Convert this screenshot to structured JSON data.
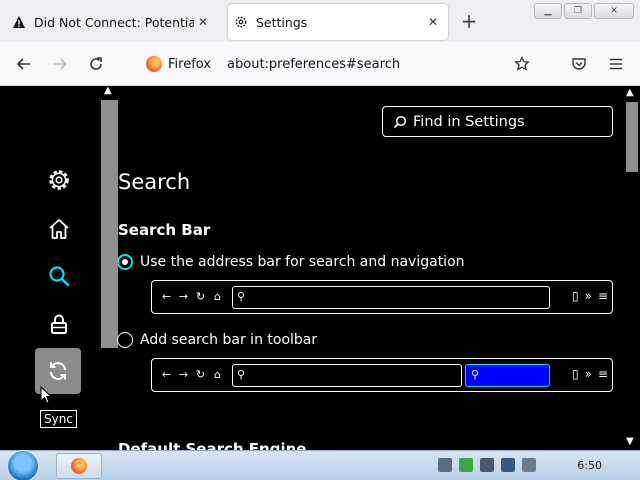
{
  "tabs": [
    {
      "title": "Did Not Connect: Potential Security Issue",
      "icon": "warning-icon"
    },
    {
      "title": "Settings",
      "icon": "gear-icon"
    }
  ],
  "navbar": {
    "brand": "Firefox",
    "url": "about:preferences#search"
  },
  "sidebar": {
    "items": [
      {
        "name": "general",
        "icon": "gear-icon"
      },
      {
        "name": "home",
        "icon": "home-icon"
      },
      {
        "name": "search",
        "icon": "search-icon",
        "selected": true
      },
      {
        "name": "privacy",
        "icon": "lock-icon"
      },
      {
        "name": "sync",
        "icon": "sync-icon"
      }
    ],
    "tooltip": "Sync"
  },
  "find": {
    "placeholder": "Find in Settings"
  },
  "main": {
    "title": "Search",
    "section": "Search Bar",
    "option_address_bar": "Use the address bar for search and navigation",
    "option_toolbar": "Add search bar in toolbar",
    "next_section": "Default Search Engine"
  },
  "taskbar": {
    "clock": "6:50"
  },
  "colors": {
    "accent": "#00ddff",
    "search_highlight": "#0000ff",
    "content_bg": "#000000"
  }
}
